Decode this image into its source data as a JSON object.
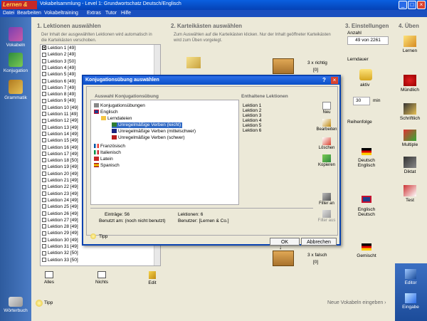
{
  "window": {
    "logo": "Lernen & Co.",
    "title": "Vokabelsammlung - Level 1: Grundwortschatz Deutsch/Englisch",
    "minimize": "_",
    "maximize": "□",
    "close": "×"
  },
  "menu": [
    "Datei",
    "Bearbeiten",
    "Vokabeltraining",
    "Extras",
    "Tutor",
    "Hilfe"
  ],
  "sidebar": {
    "items": [
      "Vokabeln",
      "Konjugation",
      "Grammatik"
    ],
    "bottom": "Wörterbuch"
  },
  "section1": {
    "header": "1. Lektionen auswählen",
    "desc": "Der Inhalt der ausgewählten Lektionen wird automatisch in die Karteikästen verschoben.",
    "lessons": [
      "Lektion 1 [49]",
      "Lektion 2 [49]",
      "Lektion 3 [50]",
      "Lektion 4 [49]",
      "Lektion 5 [49]",
      "Lektion 6 [49]",
      "Lektion 7 [49]",
      "Lektion 8 [49]",
      "Lektion 9 [49]",
      "Lektion 10 [49]",
      "Lektion 11 [49]",
      "Lektion 12 [49]",
      "Lektion 13 [49]",
      "Lektion 14 [49]",
      "Lektion 15 [49]",
      "Lektion 16 [49]",
      "Lektion 17 [49]",
      "Lektion 18 [50]",
      "Lektion 19 [49]",
      "Lektion 20 [49]",
      "Lektion 21 [49]",
      "Lektion 22 [49]",
      "Lektion 23 [49]",
      "Lektion 24 [49]",
      "Lektion 25 [49]",
      "Lektion 26 [49]",
      "Lektion 27 [49]",
      "Lektion 28 [49]",
      "Lektion 29 [49]",
      "Lektion 30 [49]",
      "Lektion 31 [49]",
      "Lektion 32 [50]",
      "Lektion 33 [50]"
    ],
    "buttons": [
      "Alles",
      "Nichts",
      "Edit"
    ]
  },
  "section2": {
    "header": "2. Karteikästen auswählen",
    "desc": "Zum Auswählen auf die Karteikästen klicken. Nur der Inhalt geöffneter Karteikästen wird zum Üben vorgelegt.",
    "box_top": {
      "label": "3 x richtig",
      "count": "[0]"
    },
    "box_bottom": {
      "label": "3 x falsch",
      "count": "[0]"
    }
  },
  "section3": {
    "header": "3. Einstellungen",
    "anzahl_label": "Anzahl",
    "anzahl_value": "49 von 2261",
    "lerndauer_label": "Lerndauer",
    "aktiv": "aktiv",
    "minutes": "30",
    "min": "min",
    "reihenfolge": "Reihenfolge",
    "orders": [
      "Deutsch\nEnglisch",
      "Englisch\nDeutsch",
      "Gemischt"
    ]
  },
  "section4": {
    "header": "4. Üben",
    "tools": [
      "Lernen",
      "Mündlich",
      "Schriftlich",
      "Multiple",
      "Diktat",
      "Test"
    ],
    "editor": "Editor",
    "eingabe": "Eingabe"
  },
  "bottom": {
    "tipp": "Tipp",
    "neue": "Neue Vokabeln eingeben ›"
  },
  "dialog": {
    "title": "Konjugationsübung auswählen",
    "help": "?",
    "close": "×",
    "left_header": "Auswahl Konjugationsübung",
    "right_header": "Enthaltene Lektionen",
    "tree": [
      "Konjugationsübungen",
      "Englisch",
      "Lerndateien",
      "Unregelmäßige Verben (leicht)",
      "Unregelmäßige Verben (mittelschwer)",
      "Unregelmäßige Verben (schwer)",
      "Französisch",
      "Italienisch",
      "Latein",
      "Spanisch"
    ],
    "lessons": [
      "Lektion 1",
      "Lektion 2",
      "Lektion 3",
      "Lektion 4",
      "Lektion 5",
      "Lektion 6"
    ],
    "tools": [
      "Neu",
      "Bearbeiten",
      "Löschen",
      "Kopieren",
      "Filter an",
      "Filter aus"
    ],
    "stats": {
      "eintraege": "Einträge: 56",
      "lektionen": "Lektionen: 6",
      "benutzt": "Benutzt am: (noch nicht benutzt)",
      "benutzer": "Benutzer: [Lernen & Co.]"
    },
    "tipp": "Tipp",
    "ok": "OK",
    "abbrechen": "Abbrechen"
  },
  "colors": {
    "accent": "#0A4FC7",
    "selection": "#316AC5",
    "sidebar": "#3A6AB0"
  }
}
